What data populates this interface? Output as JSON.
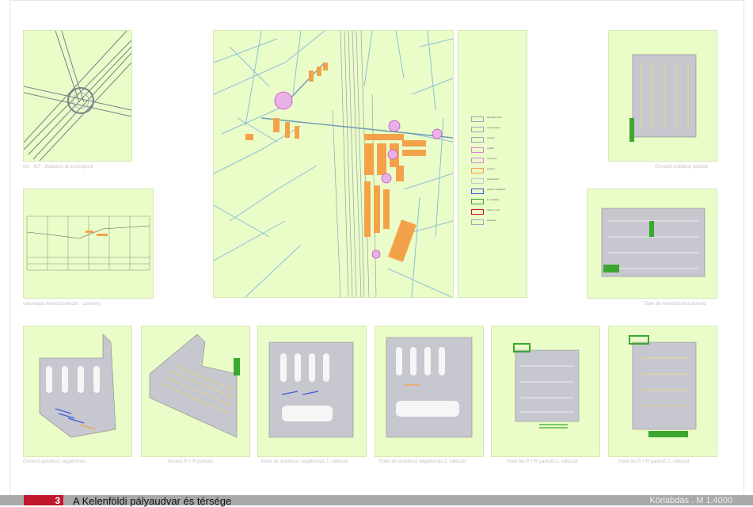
{
  "footer": {
    "number": "3",
    "title": "A Kelenföldi pályaudvar és térsége",
    "scale": "Körlabdás . M 1:4000"
  },
  "captions": {
    "junction": "M1 - M7 - Budaörsi út csomópont",
    "section": "városkapu keresztmetszet - szelvény",
    "parking_tr": "Őrmező szállásai parkoló",
    "parking_mr": "Etele tér keresztezési parkoló",
    "b1": "Őrmező autóbusz végállomás",
    "b2": "Bereck P + R parkoló",
    "b3": "Etele tér autóbusz végállomás 1. változat",
    "b4": "Etele tér autóbusz végállomás 2. változat",
    "b5": "Etele tér P + R parkoló 1. változat",
    "b6": "Etele tér P + R parkoló 2. változat"
  },
  "legend": [
    "fejlesztési terület",
    "új vasúti pálya",
    "új autóút",
    "megálló",
    "csomópont",
    "új épület",
    "parkoló felület",
    "autóbusz végállomás",
    "P + R parkoló",
    "villamos vonal",
    "kerékpárút"
  ],
  "colors": {
    "panel": "#eafcc8",
    "road_line": "#8cc0d8",
    "building": "#f3a24a",
    "marker": "#e082d8",
    "parking": "#c7c7cf",
    "footer_bar": "#a9a9a9",
    "number_box": "#c0192d"
  }
}
